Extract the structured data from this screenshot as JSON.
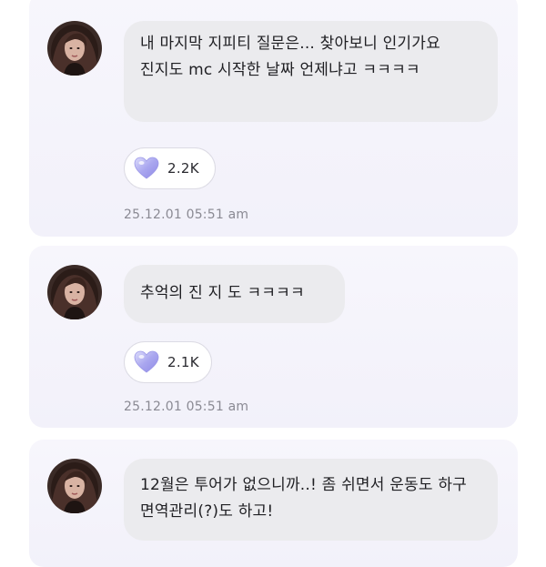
{
  "comments": [
    {
      "avatar_icon": "profile-photo",
      "text": "내 마지막 지피티 질문은... 찾아보니 인기가요 진지도 mc 시작한 날짜 언제냐고 ㅋㅋㅋㅋ",
      "reaction": {
        "icon": "heart-icon",
        "count": "2.2K"
      },
      "timestamp": "25.12.01 05:51 am"
    },
    {
      "avatar_icon": "profile-photo",
      "text": "추억의 진 지 도 ㅋㅋㅋㅋ",
      "reaction": {
        "icon": "heart-icon",
        "count": "2.1K"
      },
      "timestamp": "25.12.01 05:51 am"
    },
    {
      "avatar_icon": "profile-photo",
      "text": "12월은 투어가 없으니까..! 좀 쉬면서 운동도 하구 면역관리(?)도 하고!"
    }
  ],
  "colors": {
    "card_background": "#f4f3fb",
    "bubble_background": "#ebebee",
    "heart": "#b8b6f0",
    "timestamp": "#8a8a93"
  }
}
